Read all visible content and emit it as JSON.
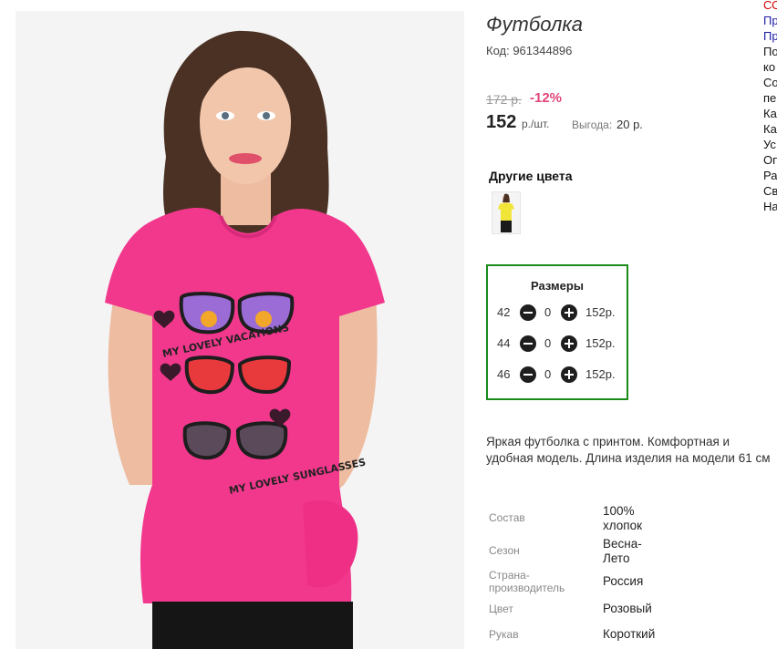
{
  "product": {
    "title": "Футболка",
    "code": "Код: 961344896",
    "old_price": "172 р.",
    "discount": "-12%",
    "price": "152",
    "price_unit": "р./шт.",
    "benefit_label": "Выгода:",
    "benefit_value": "20 р."
  },
  "print_text": {
    "line1": "MY LOVELY VACATIONS",
    "line2": "MY LOVELY SUNGLASSES"
  },
  "other_colors": {
    "label": "Другие цвета"
  },
  "sizes": {
    "title": "Размеры",
    "rows": [
      {
        "size": "42",
        "qty": "0",
        "price": "152р."
      },
      {
        "size": "44",
        "qty": "0",
        "price": "152р."
      },
      {
        "size": "46",
        "qty": "0",
        "price": "152р."
      }
    ]
  },
  "description": "Яркая футболка с принтом. Комфортная и удобная модель. Длина изделия на модели 61 см",
  "specs": [
    {
      "label": "Состав",
      "value": "100% хлопок"
    },
    {
      "label": "Сезон",
      "value": "Весна-Лето"
    },
    {
      "label": "Страна-производитель",
      "value": "Россия"
    },
    {
      "label": "Цвет",
      "value": "Розовый"
    },
    {
      "label": "Рукав",
      "value": "Короткий"
    }
  ],
  "side_links": [
    "СО",
    "Пр",
    "Пр",
    "По",
    "ко",
    "Со",
    "пе",
    "Ка",
    "Ка",
    "Ус",
    "Оп",
    "Ра",
    "Св",
    "На"
  ],
  "colors": {
    "discount": "#e0457b",
    "sizes_border": "#1a8a1a",
    "shirt": "#f2388d"
  }
}
